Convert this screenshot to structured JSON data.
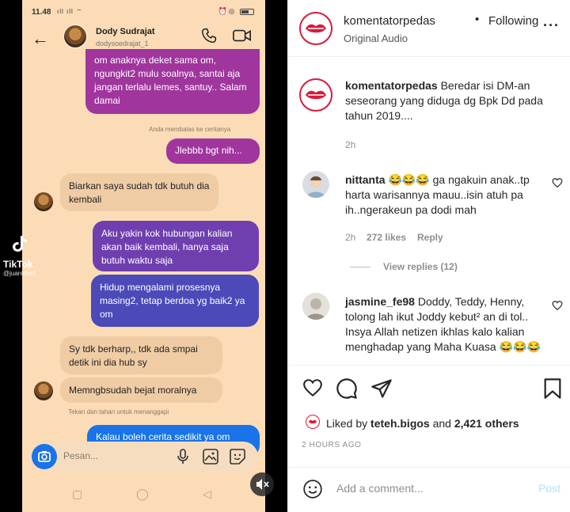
{
  "phone": {
    "status_time": "11.48",
    "status_signal": "ıll ıll ⌔",
    "chat_name": "Dody Sudrajat",
    "chat_handle": "dodysoedrajat_1",
    "messages": [
      {
        "id": "m1",
        "text": "om anaknya deket sama om, ngungkit2 mulu soalnya, santai aja jangan terlalu lemes, santuy.. Salam damai"
      },
      {
        "id": "m2_meta",
        "text": "Anda membalas ke ceritanya"
      },
      {
        "id": "m2",
        "text": "Jlebbb bgt nih..."
      },
      {
        "id": "m3",
        "text": "Biarkan saya sudah tdk butuh dia kembali"
      },
      {
        "id": "m4",
        "text": "Aku yakin kok hubungan kalian akan baik kembali, hanya saja butuh waktu saja"
      },
      {
        "id": "m5",
        "text": "Hidup mengalami prosesnya masing2, tetap berdoa yg baik2 ya om"
      },
      {
        "id": "m6",
        "text": "Sy tdk berharp,, tdk ada smpai detik ini dia hub sy"
      },
      {
        "id": "m7",
        "text": "Memngbsudah bejat moralnya"
      },
      {
        "id": "m8_meta",
        "text": "Tekan dan tahan untuk menanggapi"
      },
      {
        "id": "m8",
        "text": "Kalau boleh cerita sedikit ya om"
      }
    ],
    "input_placeholder": "Pesan...",
    "watermark_app": "TikTok",
    "watermark_user": "@juarerbeti"
  },
  "post": {
    "username": "komentatorpedas",
    "follow_status": "Following",
    "audio": "Original Audio",
    "caption_user": "komentatorpedas",
    "caption_text": "Beredar isi DM-an seseorang yang diduga dg Bpk Dd pada tahun 2019....",
    "caption_time": "2h",
    "comments": [
      {
        "user": "nittanta",
        "text": "😂😂😂 ga ngakuin anak..tp harta warisannya mauu..isin atuh pa ih..ngerakeun pa dodi mah",
        "time": "2h",
        "likes": "272 likes",
        "reply": "Reply",
        "view_replies": "View replies (12)"
      },
      {
        "user": "jasmine_fe98",
        "text": "Doddy, Teddy, Henny, tolong lah ikut Joddy kebut² an di tol.. Insya Allah netizen ikhlas kalo kalian menghadap yang Maha Kuasa 😂😂😂"
      }
    ],
    "liked_by_prefix": "Liked by",
    "liked_by_user": "teteh.bigos",
    "liked_by_and": "and",
    "liked_by_others": "2,421 others",
    "time_ago": "2 HOURS AGO",
    "add_comment_placeholder": "Add a comment...",
    "post_button": "Post"
  },
  "colors": {
    "brand_red": "#d81b3b",
    "link_blue_disabled": "#b2dffc",
    "bubble_pink": "#a0359d",
    "bubble_purple": "#6f3fb0",
    "bubble_blue": "#4b4ab8",
    "chat_bg": "#fbdcb6"
  }
}
